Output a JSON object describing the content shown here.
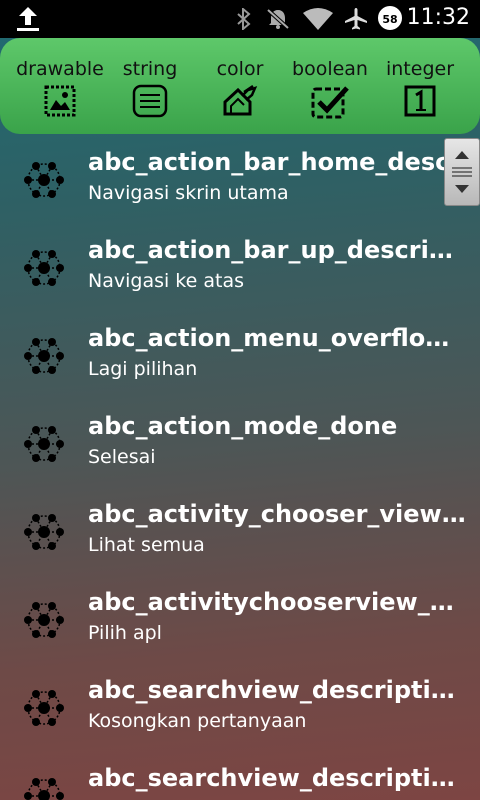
{
  "status_bar": {
    "time": "11:32",
    "battery_level": "58",
    "icons": [
      "upload-icon",
      "bluetooth-icon",
      "notifications-muted-icon",
      "wifi-icon",
      "airplane-mode-icon",
      "battery-icon"
    ]
  },
  "toolbar": {
    "tabs": [
      {
        "label": "drawable",
        "icon": "image-icon"
      },
      {
        "label": "string",
        "icon": "text-lines-icon"
      },
      {
        "label": "color",
        "icon": "paint-bucket-icon"
      },
      {
        "label": "boolean",
        "icon": "checkbox-icon"
      },
      {
        "label": "integer",
        "icon": "number-one-icon"
      }
    ]
  },
  "resource_list": [
    {
      "name": "abc_action_bar_home_description",
      "value": "Navigasi skrin utama",
      "icon": "molecule-icon"
    },
    {
      "name": "abc_action_bar_up_description",
      "value": "Navigasi ke atas",
      "icon": "molecule-icon"
    },
    {
      "name": "abc_action_menu_overflow_description",
      "value": "Lagi pilihan",
      "icon": "molecule-icon"
    },
    {
      "name": "abc_action_mode_done",
      "value": "Selesai",
      "icon": "molecule-icon"
    },
    {
      "name": "abc_activity_chooser_view_see_all",
      "value": "Lihat semua",
      "icon": "molecule-icon"
    },
    {
      "name": "abc_activitychooserview_choose_application",
      "value": "Pilih apl",
      "icon": "molecule-icon"
    },
    {
      "name": "abc_searchview_description_clear",
      "value": "Kosongkan pertanyaan",
      "icon": "molecule-icon"
    },
    {
      "name": "abc_searchview_description_query",
      "value": "",
      "icon": "molecule-icon"
    }
  ],
  "colors": {
    "toolbar_green": "#4cb85a",
    "status_bar": "#000000",
    "text": "#ffffff"
  }
}
